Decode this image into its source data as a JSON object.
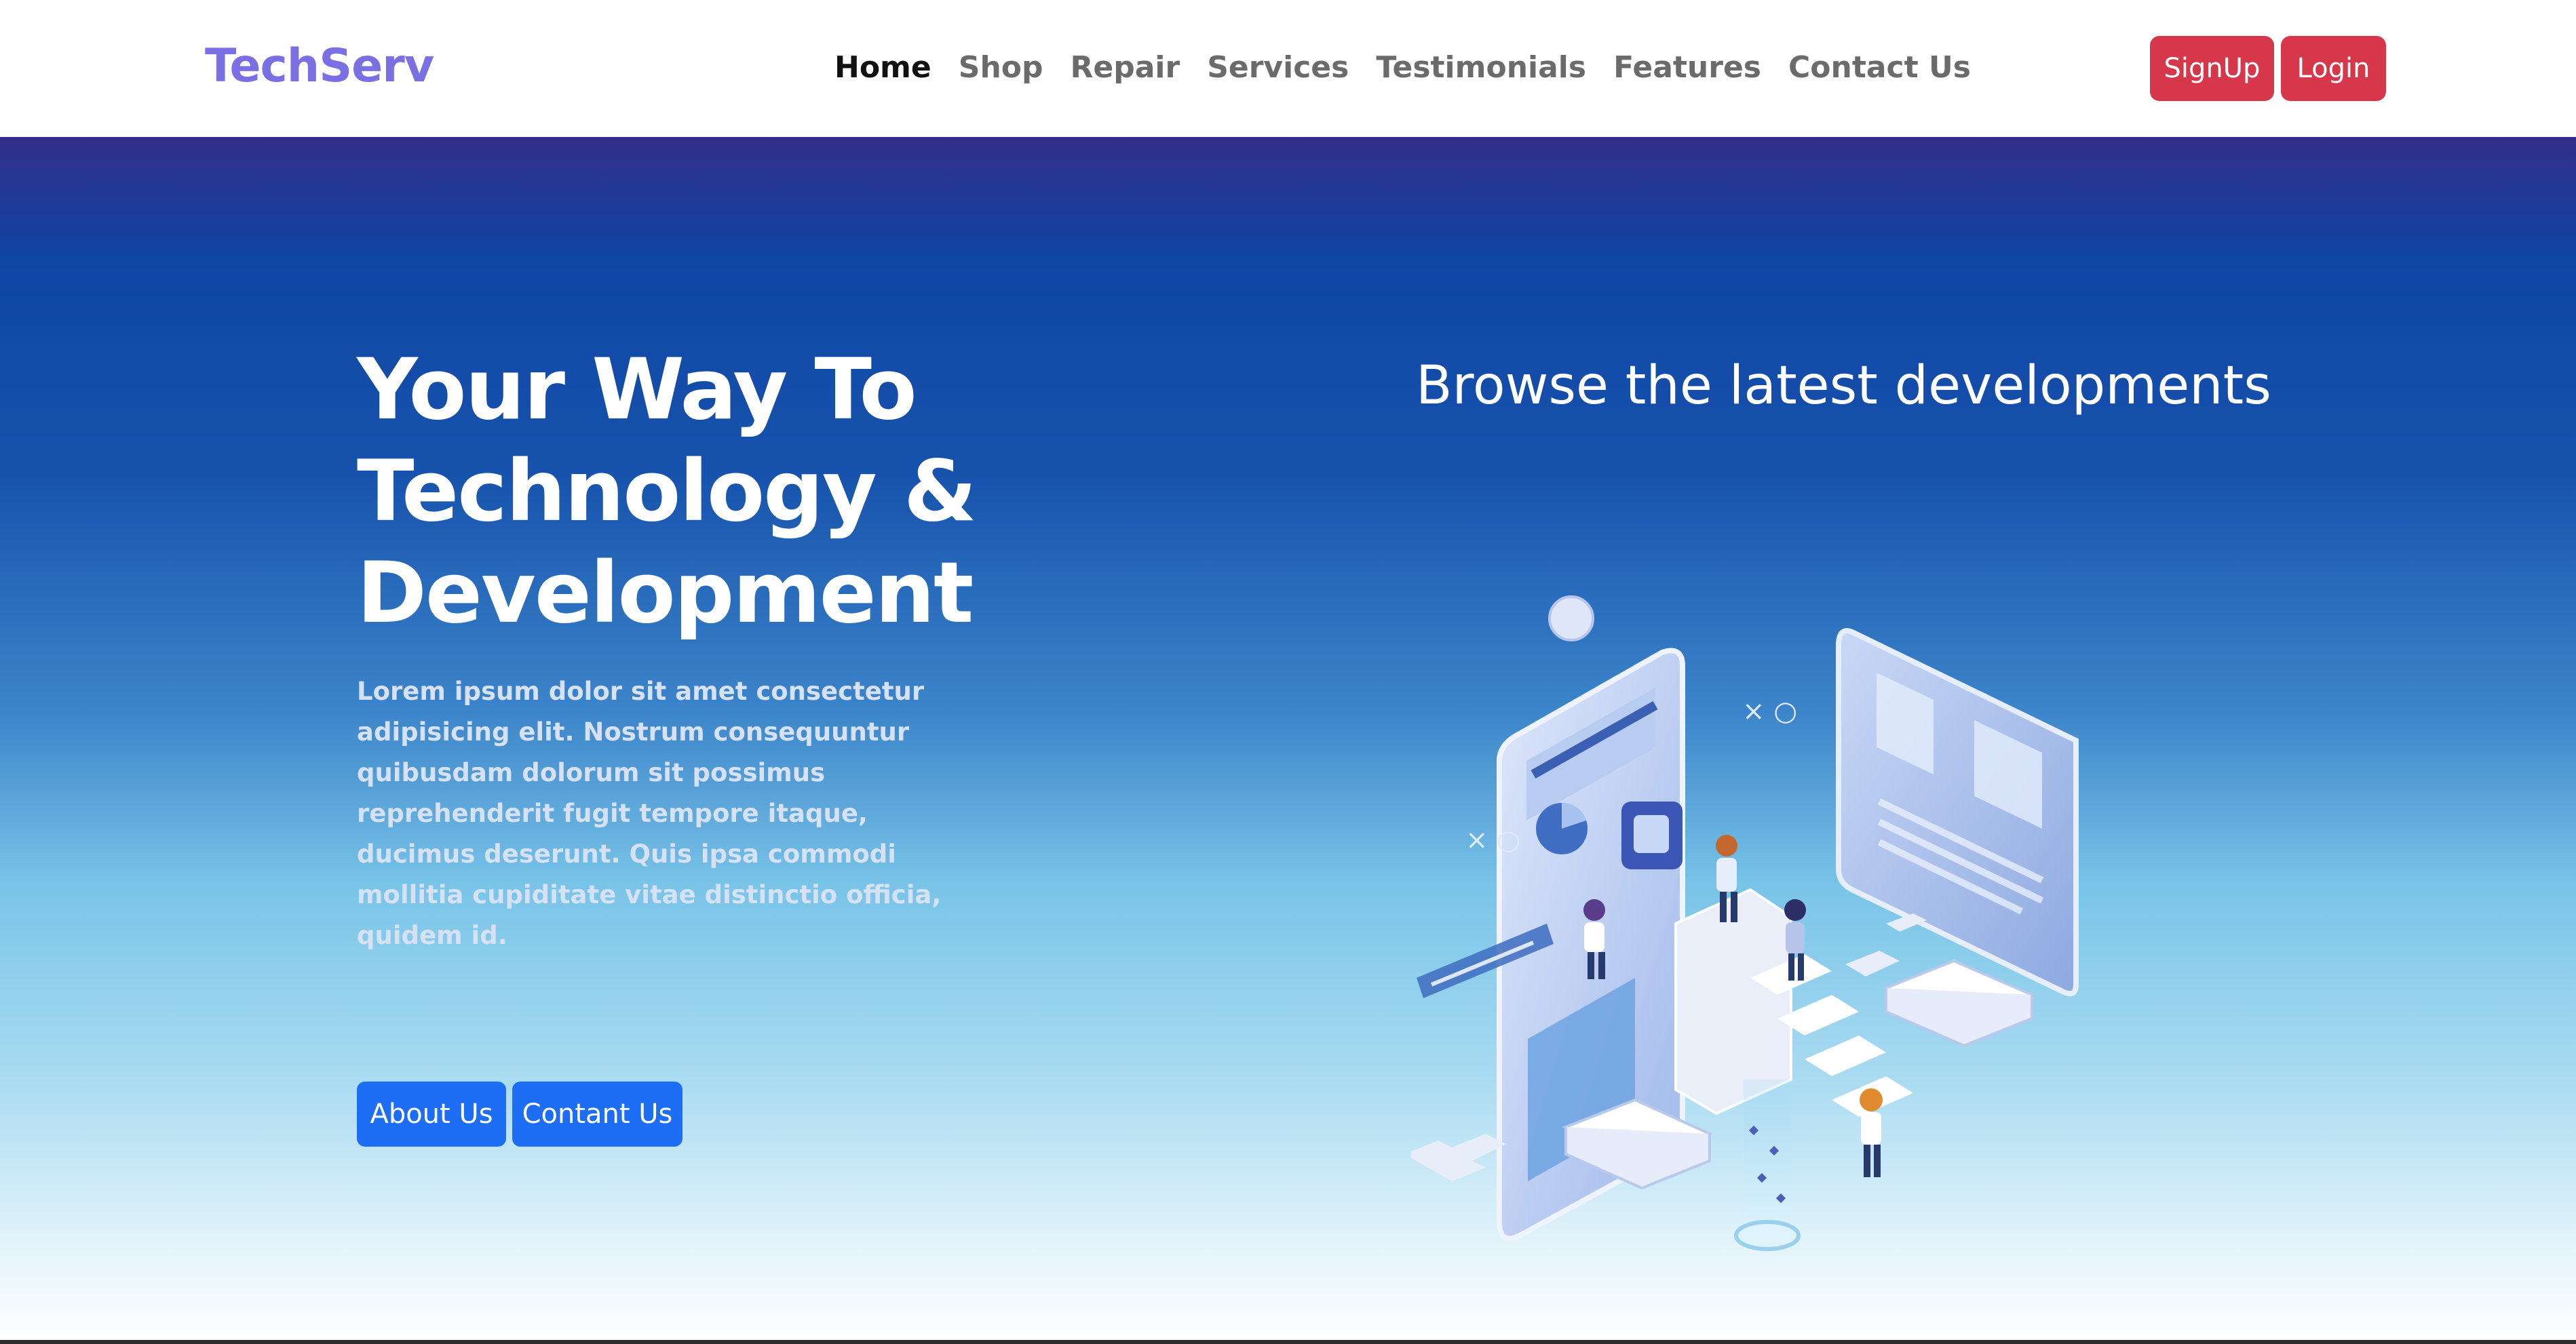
{
  "nav": {
    "brand": "TechServ",
    "links": [
      "Home",
      "Shop",
      "Repair",
      "Services",
      "Testimonials",
      "Features",
      "Contact Us"
    ],
    "signup_label": "SignUp",
    "login_label": "Login"
  },
  "hero": {
    "title": "Your Way To Technology & Development",
    "text": "Lorem ipsum dolor sit amet consectetur adipisicing elit. Nostrum consequuntur quibusdam dolorum sit possimus reprehenderit fugit tempore itaque, ducimus deserunt. Quis ipsa commodi mollitia cupiditate vitae distinctio officia, quidem id.",
    "about_label": "About Us",
    "contact_label": "Contant Us",
    "browse_title": "Browse the latest developments"
  },
  "colors": {
    "brand": "#7b6fe4",
    "auth_button": "#d7374a",
    "hero_button": "#1d6ef5"
  },
  "icons": [
    "isometric-tech-illustration"
  ]
}
